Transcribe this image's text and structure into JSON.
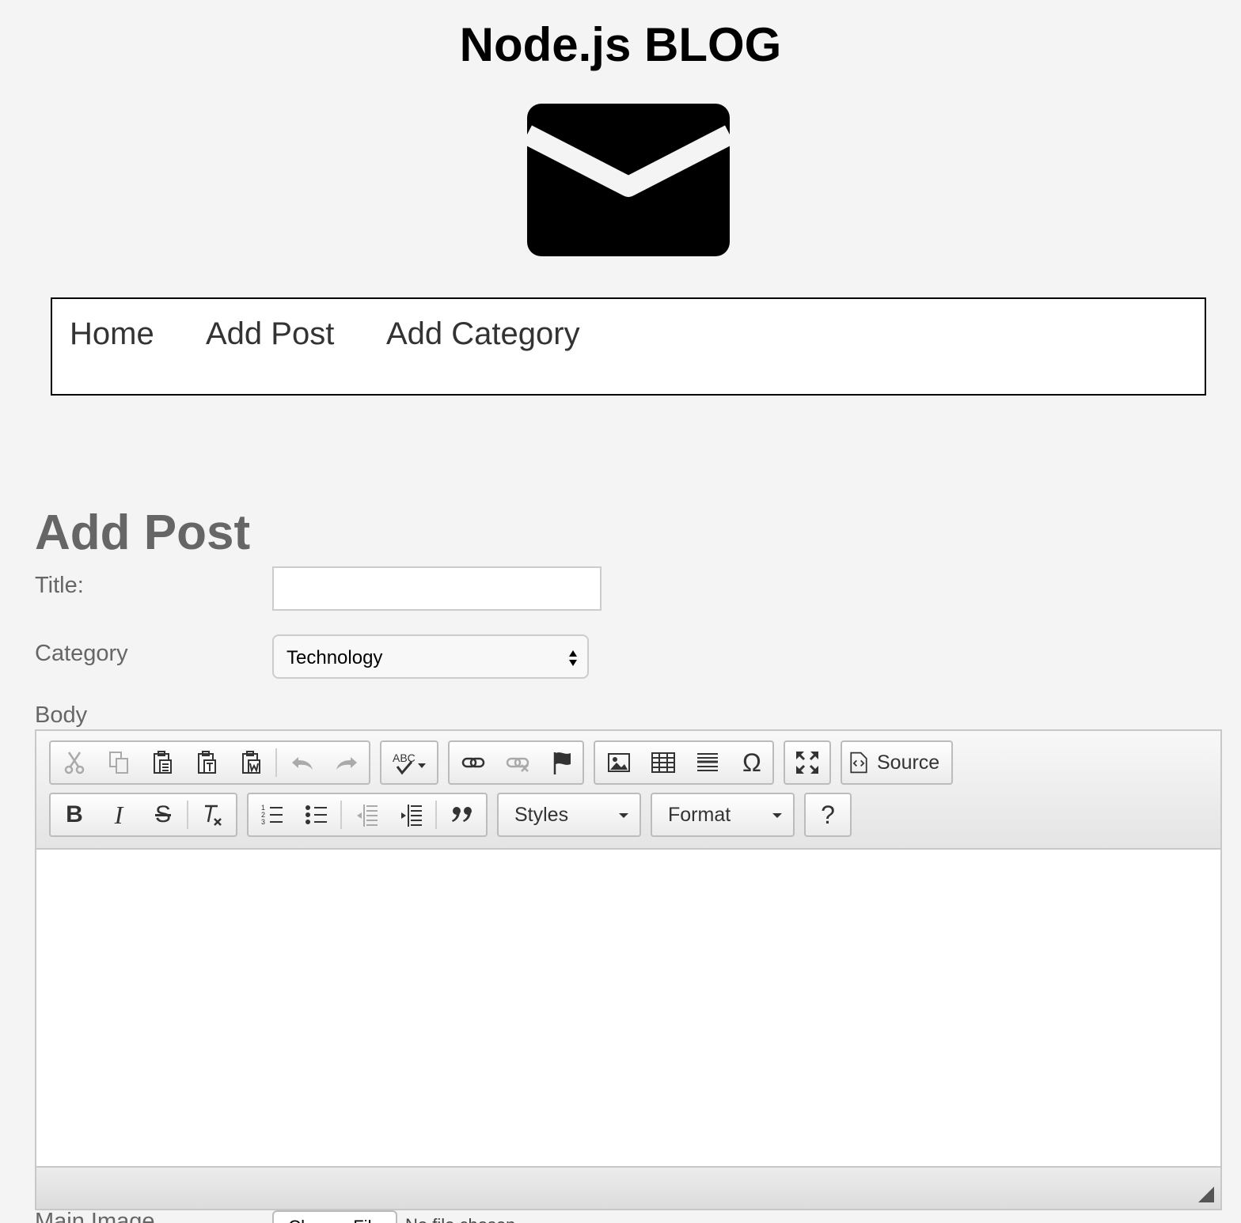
{
  "header": {
    "title": "Node.js BLOG",
    "logo_icon": "envelope-icon"
  },
  "nav": {
    "items": [
      {
        "label": "Home"
      },
      {
        "label": "Add Post"
      },
      {
        "label": "Add Category"
      }
    ]
  },
  "form": {
    "heading": "Add Post",
    "title_label": "Title:",
    "title_value": "",
    "category_label": "Category",
    "category_selected": "Technology",
    "body_label": "Body",
    "main_image_label": "Main Image",
    "choose_file_label": "Choose File",
    "no_file_text": "No file chosen"
  },
  "editor": {
    "toolbar_row1": [
      "cut-icon",
      "copy-icon",
      "paste-icon",
      "paste-text-icon",
      "paste-word-icon",
      "undo-icon",
      "redo-icon",
      "spellcheck-icon",
      "link-icon",
      "unlink-icon",
      "anchor-icon",
      "image-icon",
      "table-icon",
      "horizontal-rule-icon",
      "special-char-icon",
      "maximize-icon",
      "source-icon"
    ],
    "source_label": "Source",
    "bold_label": "B",
    "italic_label": "I",
    "strike_label": "S",
    "spell_label": "ABC",
    "styles_label": "Styles",
    "format_label": "Format",
    "help_label": "?",
    "special_char_label": "Ω",
    "content": ""
  },
  "colors": {
    "background": "#f4f4f4",
    "label": "#666666",
    "nav_text": "#333333",
    "title": "#000000"
  }
}
